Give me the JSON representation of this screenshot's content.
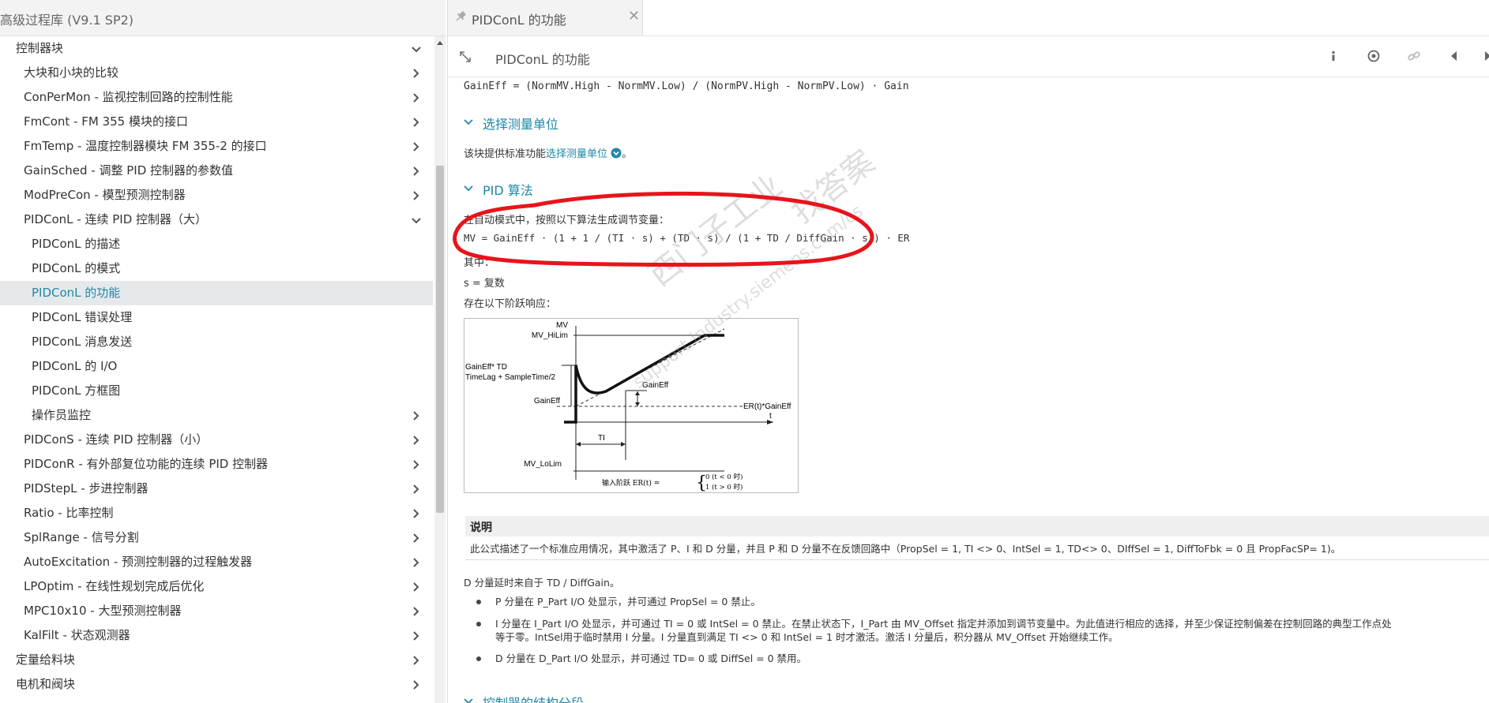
{
  "left_panel": {
    "library_title": "高级过程库 (V9.1 SP2)",
    "tree": [
      {
        "label": "控制器块",
        "level": 0,
        "chevron": "down",
        "selected": false
      },
      {
        "label": "大块和小块的比较",
        "level": 1,
        "chevron": "right",
        "selected": false
      },
      {
        "label": "ConPerMon - 监视控制回路的控制性能",
        "level": 1,
        "chevron": "right",
        "selected": false
      },
      {
        "label": "FmCont - FM 355 模块的接口",
        "level": 1,
        "chevron": "right",
        "selected": false
      },
      {
        "label": "FmTemp - 温度控制器模块 FM 355-2 的接口",
        "level": 1,
        "chevron": "right",
        "selected": false
      },
      {
        "label": "GainSched - 调整 PID 控制器的参数值",
        "level": 1,
        "chevron": "right",
        "selected": false
      },
      {
        "label": "ModPreCon - 模型预测控制器",
        "level": 1,
        "chevron": "right",
        "selected": false
      },
      {
        "label": "PIDConL - 连续 PID 控制器（大）",
        "level": 1,
        "chevron": "down",
        "selected": false
      },
      {
        "label": "PIDConL 的描述",
        "level": 2,
        "chevron": "",
        "selected": false
      },
      {
        "label": "PIDConL 的模式",
        "level": 2,
        "chevron": "",
        "selected": false
      },
      {
        "label": "PIDConL 的功能",
        "level": 2,
        "chevron": "",
        "selected": true
      },
      {
        "label": "PIDConL 错误处理",
        "level": 2,
        "chevron": "",
        "selected": false
      },
      {
        "label": "PIDConL 消息发送",
        "level": 2,
        "chevron": "",
        "selected": false
      },
      {
        "label": "PIDConL 的 I/O",
        "level": 2,
        "chevron": "",
        "selected": false
      },
      {
        "label": "PIDConL 方框图",
        "level": 2,
        "chevron": "",
        "selected": false
      },
      {
        "label": "操作员监控",
        "level": 2,
        "chevron": "right",
        "selected": false
      },
      {
        "label": "PIDConS - 连续 PID 控制器（小）",
        "level": 1,
        "chevron": "right",
        "selected": false
      },
      {
        "label": "PIDConR - 有外部复位功能的连续 PID 控制器",
        "level": 1,
        "chevron": "right",
        "selected": false
      },
      {
        "label": "PIDStepL - 步进控制器",
        "level": 1,
        "chevron": "right",
        "selected": false
      },
      {
        "label": "Ratio - 比率控制",
        "level": 1,
        "chevron": "right",
        "selected": false
      },
      {
        "label": "SplRange - 信号分割",
        "level": 1,
        "chevron": "right",
        "selected": false
      },
      {
        "label": "AutoExcitation - 预测控制器的过程触发器",
        "level": 1,
        "chevron": "right",
        "selected": false
      },
      {
        "label": "LPOptim - 在线性规划完成后优化",
        "level": 1,
        "chevron": "right",
        "selected": false
      },
      {
        "label": "MPC10x10 - 大型预测控制器",
        "level": 1,
        "chevron": "right",
        "selected": false
      },
      {
        "label": "KalFilt - 状态观测器",
        "level": 1,
        "chevron": "right",
        "selected": false
      },
      {
        "label": "定量给料块",
        "level": 0,
        "chevron": "right",
        "selected": false
      },
      {
        "label": "电机和阀块",
        "level": 0,
        "chevron": "right",
        "selected": false
      }
    ]
  },
  "tab": {
    "title": "PIDConL 的功能",
    "pin_icon": "pin-icon",
    "close_glyph": "✕"
  },
  "toolbar": {
    "title": "PIDConL 的功能",
    "icons": [
      "info-icon",
      "target-icon",
      "link-icon",
      "back-icon",
      "forward-icon"
    ]
  },
  "content": {
    "gain_formula": "GainEff = (NormMV.High - NormMV.Low) / (NormPV.High - NormPV.Low) · Gain",
    "section1_title": "选择测量单位",
    "section1_text": "该块提供标准功能",
    "section1_link": "选择测量单位",
    "section1_end": "。",
    "section2_title": "PID 算法",
    "auto_mode_text": "在自动模式中，按照以下算法生成调节变量：",
    "mv_formula": "MV = GainEff · (1 + 1 / (TI · s) + (TD · s) / (1 + TD / DiffGain · s)) · ER",
    "where_text": "其中：",
    "s_text": "s = 复数",
    "step_text": "存在以下阶跃响应：",
    "note_title": "说明",
    "note_text": "此公式描述了一个标准应用情况，其中激活了 P、I 和 D 分量，并且 P 和 D 分量不在反馈回路中（PropSel = 1, TI <> 0、IntSel = 1, TD<> 0、DIffSel = 1, DiffToFbk = 0 且 PropFacSP= 1)。",
    "d_delay_text": "D 分量延时来自于 TD / DiffGain。",
    "bullet1": "P 分量在 P_Part I/O 处显示，并可通过 PropSel = 0 禁止。",
    "bullet2_line1": "I 分量在 I_Part I/O 处显示，并可通过 TI  =  0 或 IntSel = 0 禁止。在禁止状态下，I_Part 由 MV_Offset 指定并添加到调节变量中。为此值进行相应的选择，并至少保证控制偏差在控制回路的典型工作点处",
    "bullet2_line2": "等于零。IntSel用于临时禁用 I 分量。I 分量直到满足 TI  <>  0 和 IntSel  =  1 时才激活。激活 I 分量后，积分器从 MV_Offset 开始继续工作。",
    "bullet3": "D 分量在 D_Part I/O 处显示，并可通过 TD= 0 或 DiffSel = 0 禁用。",
    "section3_title": "控制器的结构分段"
  },
  "diagram": {
    "label_mv": "MV",
    "label_mv_hilim": "MV_HiLim",
    "label_gaineff_td": "GainEff* TD",
    "label_timelag": "TimeLag + SampleTime/2",
    "label_gaineff_left": "GainEff",
    "label_gaineff_mid": "GainEff",
    "label_er_gaineff": "ER(t)*GainEff",
    "label_ti": "TI",
    "label_t": "t",
    "label_mv_lolim": "MV_LoLim",
    "label_input_step": "输入阶跃 ER(t) =",
    "label_case1": "0 (t < 0 时)",
    "label_case2": "1 (t > 0 时)"
  },
  "watermark": {
    "line1": "西门子工业",
    "line2": "找答案",
    "line3": "support.industry.siemens.com/cs"
  },
  "colors": {
    "accent": "#1f88a8",
    "selected_bg": "#e6e9ec",
    "annotation": "#e8141b"
  }
}
